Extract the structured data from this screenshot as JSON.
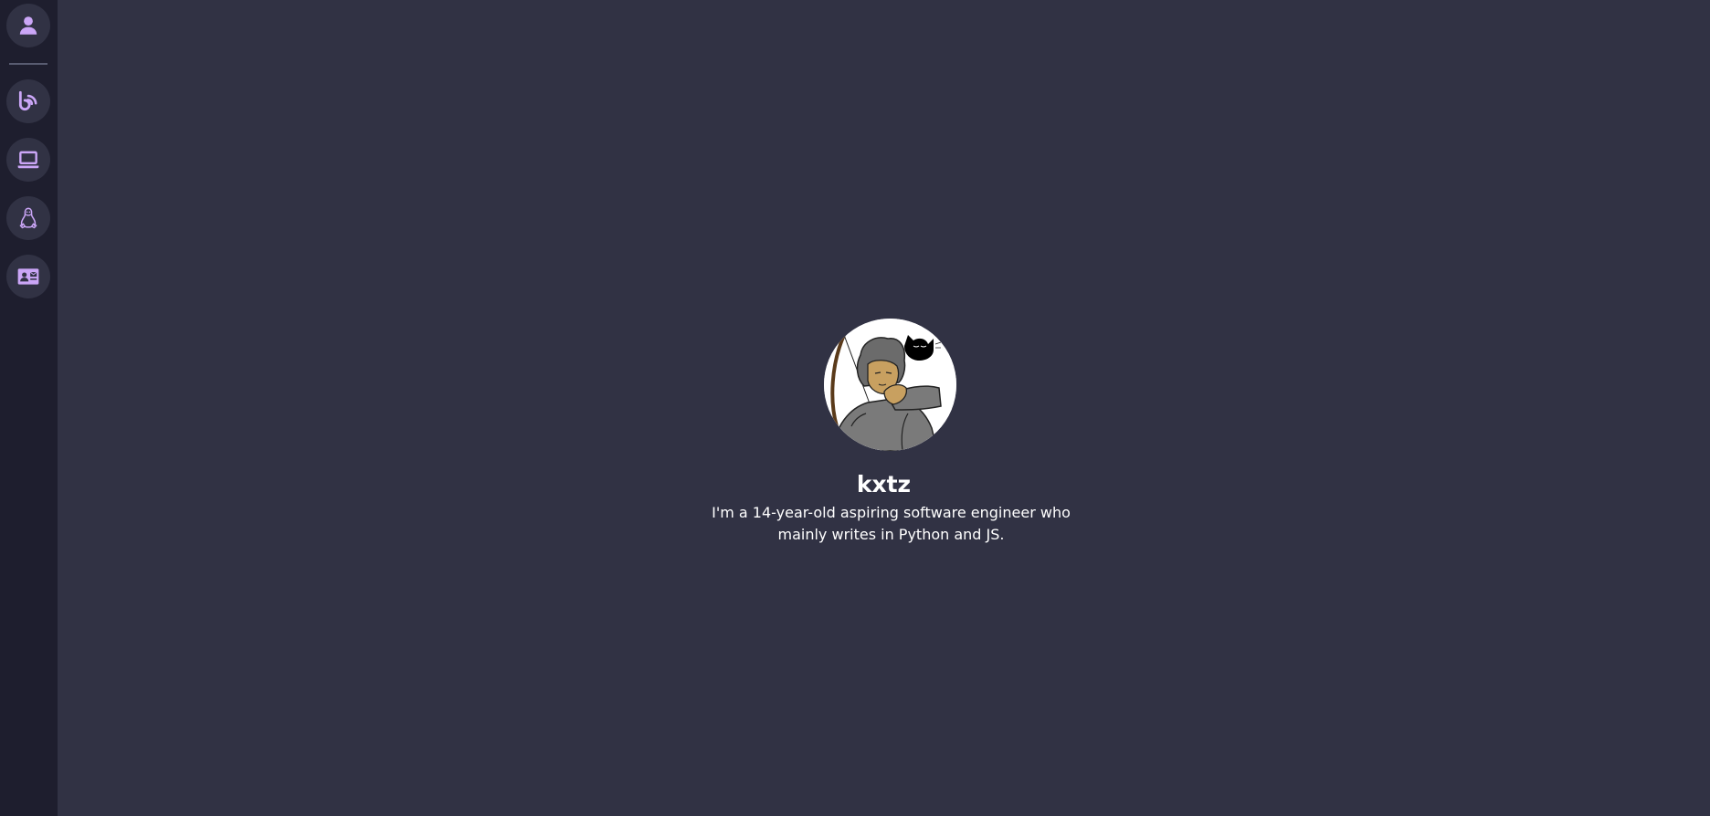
{
  "sidebar": {
    "items": [
      {
        "icon": "user-icon",
        "label": "About"
      },
      {
        "icon": "blog-feed-icon",
        "label": "Blog"
      },
      {
        "icon": "laptop-icon",
        "label": "Projects"
      },
      {
        "icon": "linux-tux-icon",
        "label": "Linux"
      },
      {
        "icon": "contact-card-icon",
        "label": "Contact"
      }
    ],
    "accent_color": "#cba6f7",
    "background_color": "#1e1e2e"
  },
  "profile": {
    "name": "kxtz",
    "bio": "I'm a 14-year-old aspiring software engineer who mainly writes in Python and JS."
  },
  "colors": {
    "page_background": "#313244",
    "text": "#ffffff"
  }
}
